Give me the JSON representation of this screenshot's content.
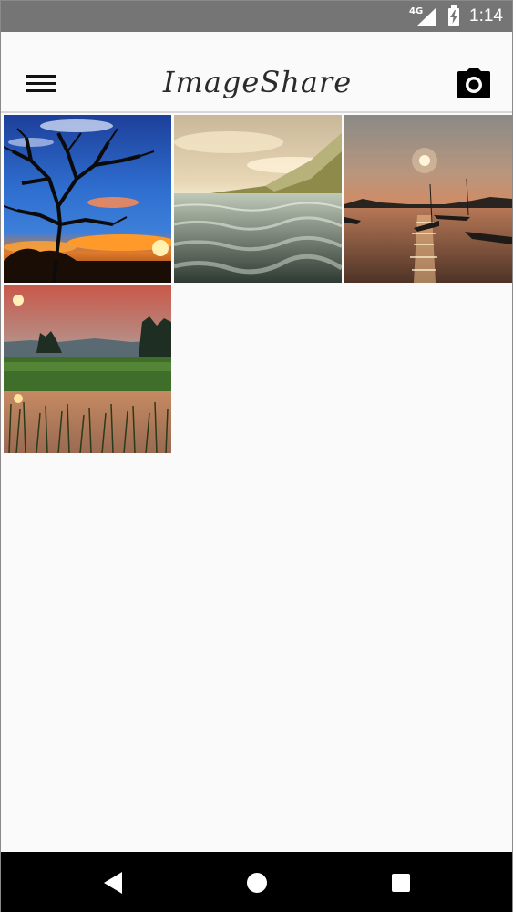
{
  "status_bar": {
    "network_label": "4G",
    "time": "1:14",
    "icons": [
      "signal-icon",
      "battery-charging-icon"
    ]
  },
  "app_bar": {
    "title": "ImageShare",
    "menu_icon": "hamburger-menu-icon",
    "camera_icon": "camera-icon"
  },
  "gallery": {
    "images": [
      {
        "name": "photo-bare-tree-sunset"
      },
      {
        "name": "photo-lake-hillside"
      },
      {
        "name": "photo-boats-sunset"
      },
      {
        "name": "photo-marsh-sunset"
      }
    ]
  },
  "nav_bar": {
    "icons": [
      "back-icon",
      "home-icon",
      "recents-icon"
    ]
  },
  "colors": {
    "status_bar": "#757575",
    "app_bar": "#fafafa",
    "nav_bar": "#000000"
  }
}
